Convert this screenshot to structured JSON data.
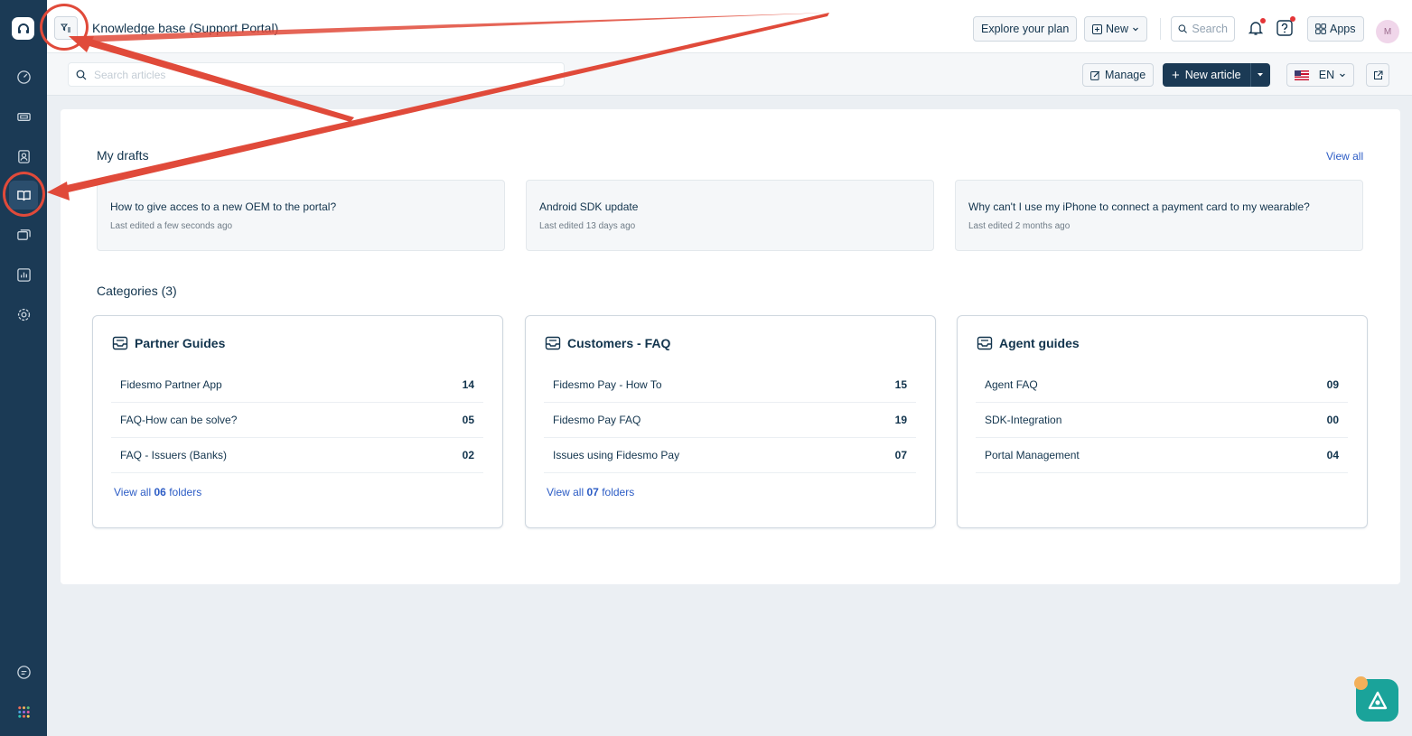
{
  "app": {
    "page_title": "Knowledge base (Support Portal)"
  },
  "topbar": {
    "explore_label": "Explore your plan",
    "new_label": "New",
    "search_placeholder": "Search",
    "apps_label": "Apps",
    "avatar_initial": "M"
  },
  "subbar": {
    "search_placeholder": "Search articles",
    "manage_label": "Manage",
    "new_article_label": "New article",
    "language": "EN"
  },
  "drafts": {
    "title": "My drafts",
    "view_all": "View all",
    "items": [
      {
        "title": "How to give acces to a new OEM to the portal?",
        "meta": "Last edited a few seconds ago"
      },
      {
        "title": "Android SDK update",
        "meta": "Last edited 13 days ago"
      },
      {
        "title": "Why can't I use my iPhone to connect a payment card to my wearable?",
        "meta": "Last edited 2 months ago"
      }
    ]
  },
  "categories": {
    "title": "Categories (3)",
    "items": [
      {
        "name": "Partner Guides",
        "folders": [
          {
            "name": "Fidesmo Partner App",
            "count": "14"
          },
          {
            "name": "FAQ-How can be solve?",
            "count": "05"
          },
          {
            "name": "FAQ - Issuers (Banks)",
            "count": "02"
          }
        ],
        "view_all_prefix": "View all",
        "view_all_count": "06",
        "view_all_suffix": "folders"
      },
      {
        "name": "Customers - FAQ",
        "folders": [
          {
            "name": "Fidesmo Pay - How To",
            "count": "15"
          },
          {
            "name": "Fidesmo Pay FAQ",
            "count": "19"
          },
          {
            "name": "Issues using Fidesmo Pay",
            "count": "07"
          }
        ],
        "view_all_prefix": "View all",
        "view_all_count": "07",
        "view_all_suffix": "folders"
      },
      {
        "name": "Agent guides",
        "folders": [
          {
            "name": "Agent FAQ",
            "count": "09"
          },
          {
            "name": "SDK-Integration",
            "count": "00"
          },
          {
            "name": "Portal Management",
            "count": "04"
          }
        ]
      }
    ]
  },
  "sidebar": {
    "items": [
      "dashboard-icon",
      "tickets-icon",
      "contacts-icon",
      "knowledge-base-icon",
      "conversations-icon",
      "reports-icon",
      "settings-icon"
    ],
    "active": "knowledge-base-icon"
  },
  "colors": {
    "sidebar_bg": "#1b3a55",
    "link": "#2c5cc5",
    "annotation": "#e04a3a",
    "fab": "#1aa39a"
  }
}
